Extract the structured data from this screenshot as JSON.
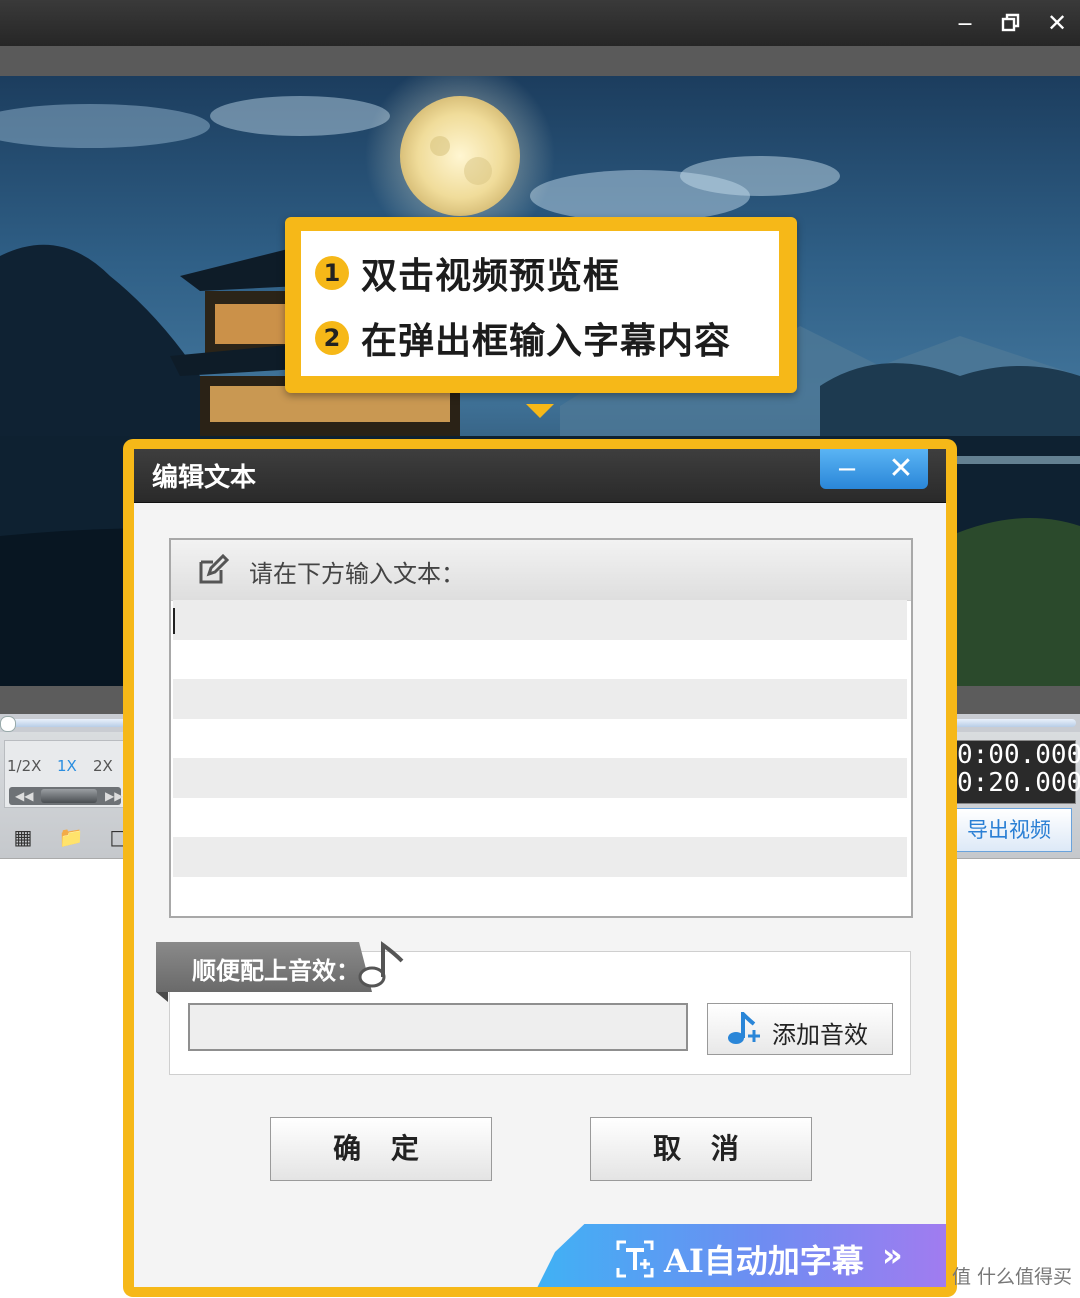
{
  "window": {
    "minimize_icon": "minimize-icon",
    "restore_icon": "restore-icon",
    "close_icon": "close-icon"
  },
  "callout": {
    "steps": [
      {
        "num": "1",
        "text": "双击视频预览框"
      },
      {
        "num": "2",
        "text": "在弹出框输入字幕内容"
      }
    ],
    "color": "#f6b818"
  },
  "player": {
    "speeds": [
      "1/2X",
      "1X",
      "2X"
    ],
    "active_speed": "1X",
    "current_time": "0:00.000",
    "total_time": "0:20.000",
    "export_label": "导出视频"
  },
  "dialog": {
    "title": "编辑文本",
    "text_prompt": "请在下方输入文本：",
    "text_value": "",
    "sound_label": "顺便配上音效：",
    "sound_value": "",
    "add_sound_label": "添加音效",
    "ok_label": "确 定",
    "cancel_label": "取 消",
    "ai_banner_label": "AI自动加字幕",
    "ai_banner_chevron": "»",
    "accent": "#2a86d8"
  },
  "watermark": "值 什么值得买"
}
